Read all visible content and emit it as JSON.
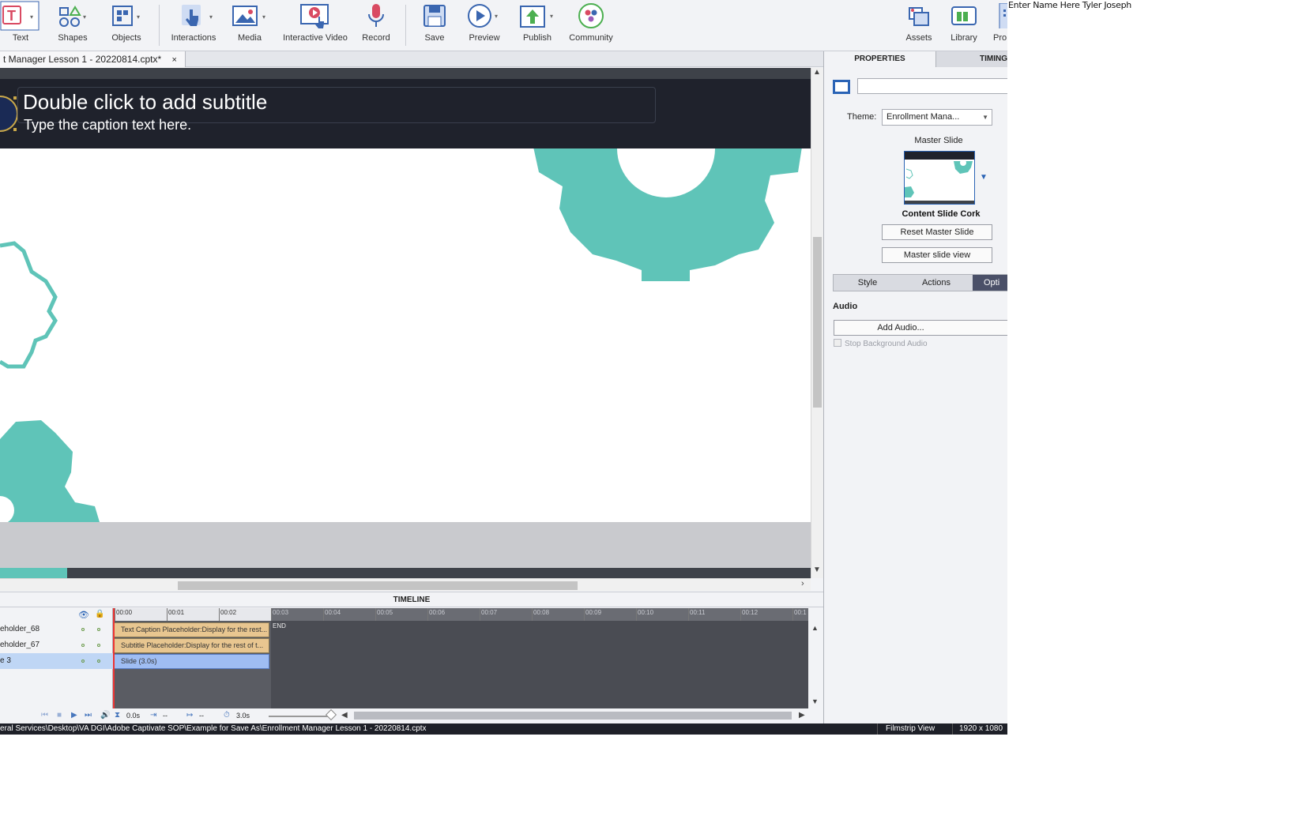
{
  "toolbar": {
    "buttons": [
      {
        "label": "Text",
        "icon": "text-icon"
      },
      {
        "label": "Shapes",
        "icon": "shapes-icon"
      },
      {
        "label": "Objects",
        "icon": "objects-icon"
      },
      {
        "label": "Interactions",
        "icon": "interactions-icon"
      },
      {
        "label": "Media",
        "icon": "media-icon"
      },
      {
        "label": "Interactive Video",
        "icon": "interactive-video-icon"
      },
      {
        "label": "Record",
        "icon": "microphone-icon"
      },
      {
        "label": "Save",
        "icon": "save-icon"
      },
      {
        "label": "Preview",
        "icon": "preview-play-icon"
      },
      {
        "label": "Publish",
        "icon": "publish-icon"
      },
      {
        "label": "Community",
        "icon": "community-icon"
      },
      {
        "label": "Assets",
        "icon": "assets-icon"
      },
      {
        "label": "Library",
        "icon": "library-icon"
      },
      {
        "label": "Pro",
        "icon": "properties-icon"
      }
    ]
  },
  "document": {
    "tab_title": "t Manager Lesson 1 - 20220814.cptx*",
    "close": "×"
  },
  "stage": {
    "subtitle_title": "Double click to add subtitle",
    "subtitle_caption": "Type the caption text here."
  },
  "timeline": {
    "title": "TIMELINE",
    "layers": [
      {
        "name": "eholder_68"
      },
      {
        "name": "eholder_67"
      },
      {
        "name": "e 3"
      }
    ],
    "ruler_ticks": [
      "00:00",
      "00:01",
      "00:02",
      "00:03",
      "00:04",
      "00:05",
      "00:06",
      "00:07",
      "00:08",
      "00:09",
      "00:10",
      "00:11",
      "00:12",
      "00:1"
    ],
    "clips": [
      {
        "label": "Text Caption Placeholder:Display for the rest..."
      },
      {
        "label": "Subtitle Placeholder:Display for the rest of t..."
      },
      {
        "label": "Slide (3.0s)"
      }
    ],
    "end_label": "END",
    "controls": {
      "current_time": "0.0s",
      "in_point": "--",
      "duration_point": "--",
      "slide_duration": "3.0s"
    }
  },
  "statusbar": {
    "path": "eral Services\\Desktop\\VA DGI\\Adobe Captivate SOP\\Example for Save As\\Enrollment Manager Lesson 1 - 20220814.cptx",
    "view": "Filmstrip View",
    "resolution": "1920 x 1080"
  },
  "properties": {
    "tabs": [
      "PROPERTIES",
      "TIMING"
    ],
    "theme_label": "Theme:",
    "theme_value": "Enrollment Mana...",
    "master_slide_label": "Master Slide",
    "master_slide_name": "Content Slide Cork",
    "reset_button": "Reset Master Slide",
    "view_button": "Master slide view",
    "sub_tabs": [
      "Style",
      "Actions",
      "Opti"
    ],
    "audio_label": "Audio",
    "add_audio": "Add Audio...",
    "stop_bg_audio": "Stop Background Audio"
  },
  "overflow_text": "Enter Name Here Tyler Joseph",
  "colors": {
    "teal": "#5fc4b8",
    "accent_blue": "#2a63b5",
    "dark_band": "#1f222c"
  }
}
